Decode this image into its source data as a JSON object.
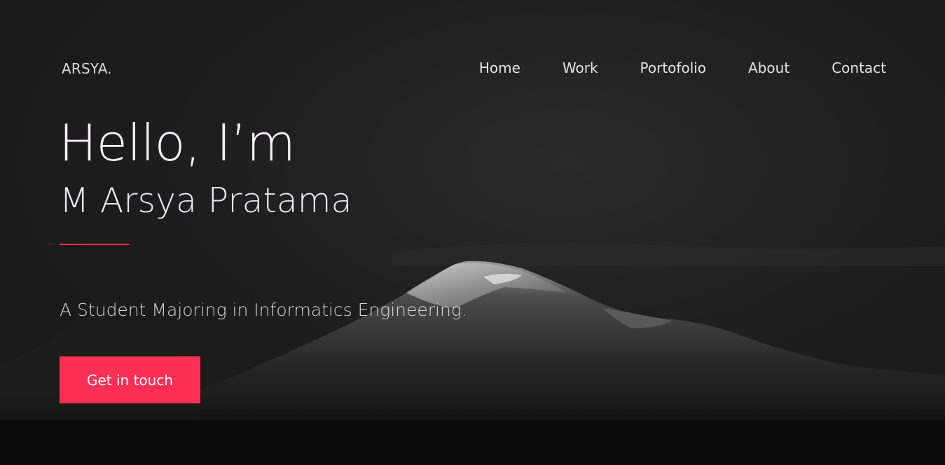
{
  "header": {
    "logo": "ARSYA.",
    "nav": [
      {
        "label": "Home"
      },
      {
        "label": "Work"
      },
      {
        "label": "Portofolio"
      },
      {
        "label": "About"
      },
      {
        "label": "Contact"
      }
    ]
  },
  "hero": {
    "greeting": "Hello, I’m",
    "name": "M Arsya Pratama",
    "subtitle": "A Student Majoring in Informatics Engineering.",
    "cta_label": "Get in touch",
    "background_image": "mountain-photo"
  },
  "colors": {
    "accent": "#ff2f55",
    "background": "#1b1b1b",
    "text": "#eae6ee"
  }
}
